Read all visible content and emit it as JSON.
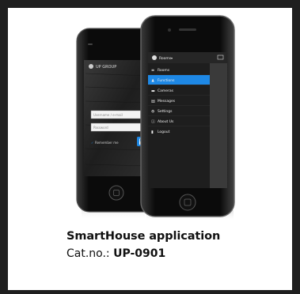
{
  "product": {
    "title": "SmartHouse application",
    "catno_label": "Cat.no.:",
    "catno_value": "UP-0901"
  },
  "back_phone": {
    "brand": "UP GROUP",
    "username_placeholder": "Username / e-mail",
    "password_placeholder": "Password",
    "remember_label": "Remember me"
  },
  "front_phone": {
    "header_title": "Rooms",
    "menu_items": [
      {
        "label": "Rooms",
        "icon": "list-icon"
      },
      {
        "label": "Functions",
        "icon": "person-icon"
      },
      {
        "label": "Cameras",
        "icon": "camera-icon"
      },
      {
        "label": "Messages",
        "icon": "message-icon"
      },
      {
        "label": "Settings",
        "icon": "gear-icon"
      },
      {
        "label": "About Us",
        "icon": "info-icon"
      },
      {
        "label": "Logout",
        "icon": "lock-icon"
      }
    ],
    "selected_index": 1
  },
  "colors": {
    "accent": "#1e88e5",
    "phone_body": "#0d0d0d",
    "screen_dark": "#2b2b2b"
  }
}
